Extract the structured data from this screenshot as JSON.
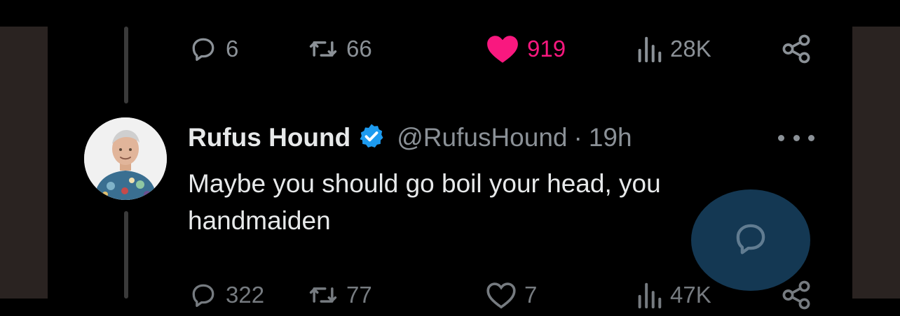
{
  "top_actions": {
    "replies": "6",
    "retweets": "66",
    "likes": "919",
    "views": "28K"
  },
  "reply_tweet": {
    "display_name": "Rufus Hound",
    "handle": "@RufusHound",
    "separator": "·",
    "time": "19h",
    "text": "Maybe you should go boil your head, you handmaiden",
    "actions": {
      "replies": "322",
      "retweets": "77",
      "likes": "7",
      "views": "47K"
    }
  },
  "colors": {
    "background": "#000000",
    "muted": "#8b9197",
    "text": "#e7e9ea",
    "like": "#f9187f",
    "verified": "#1d9bf0",
    "fab": "#17405f"
  },
  "icons": {
    "reply": "speech-bubble-icon",
    "retweet": "retweet-icon",
    "like": "heart-icon",
    "views": "bar-chart-icon",
    "share": "share-icon",
    "verified": "verified-badge-icon",
    "more": "more-dots-icon",
    "compose_reply": "compose-reply-icon"
  }
}
